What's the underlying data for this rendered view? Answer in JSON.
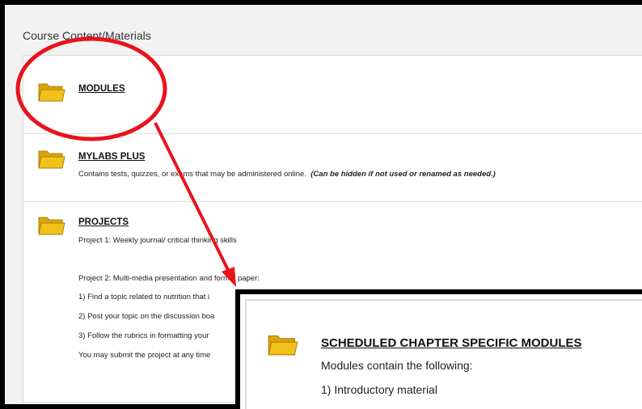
{
  "page": {
    "title": "Course Content/Materials"
  },
  "items": [
    {
      "title": "MODULES"
    },
    {
      "title": "MYLABS PLUS",
      "description": "Contains tests, quizzes, or exams that may be administered online.",
      "note": "(Can be hidden if not used or renamed as needed.)"
    },
    {
      "title": "PROJECTS",
      "lines": [
        "Project 1:  Weekly journal/ critical thinking skills",
        "Project 2: Multi-media presentation and formal paper:",
        "1) Find a topic related to nutrition that i",
        "2) Post your topic on the discussion boa",
        "3) Follow the rubrics in formatting your",
        "You may submit the project at any time"
      ]
    }
  ],
  "zoom": {
    "title": "SCHEDULED CHAPTER SPECIFIC MODULES",
    "lines": [
      "Modules contain the following:",
      "1) Introductory material"
    ]
  },
  "colors": {
    "folder_fill": "#f2c21b",
    "folder_stroke": "#b07f00",
    "annotation_red": "#e8141b"
  },
  "icons": {
    "folder": "folder-icon"
  }
}
